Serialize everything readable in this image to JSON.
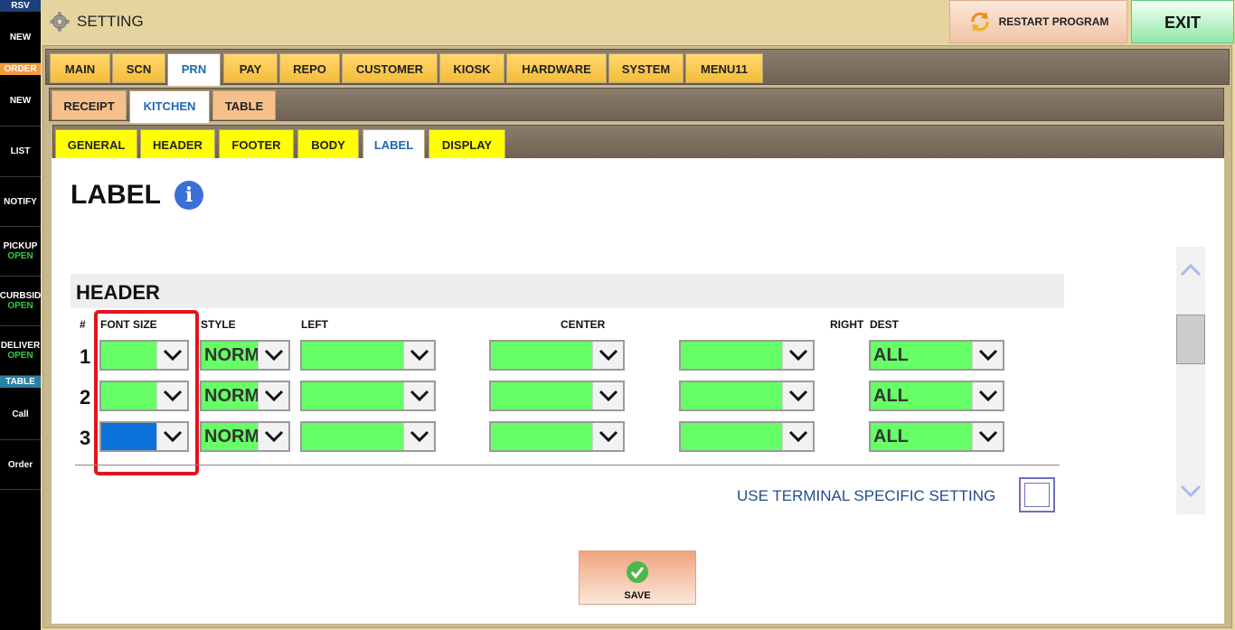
{
  "sidebar": {
    "badges": {
      "rsv": "RSV",
      "order": "ORDER",
      "table": "TABLE"
    },
    "items": [
      {
        "label": "NEW",
        "sub": ""
      },
      {
        "label": "NEW",
        "sub": ""
      },
      {
        "label": "LIST",
        "sub": ""
      },
      {
        "label": "NOTIFY",
        "sub": ""
      },
      {
        "label": "PICKUP",
        "sub": "OPEN"
      },
      {
        "label": "CURBSID",
        "sub": "OPEN"
      },
      {
        "label": "DELIVER",
        "sub": "OPEN"
      },
      {
        "label": "Call",
        "sub": ""
      },
      {
        "label": "Order",
        "sub": ""
      }
    ],
    "colors": {
      "badge_order": "#f39b3c",
      "badge_rsv": "#1f3f7a",
      "badge_table": "#2a7fa8",
      "open_text": "#2ecc40"
    }
  },
  "topbar": {
    "title": "SETTING",
    "restart_label": "RESTART PROGRAM",
    "exit_label": "EXIT",
    "icons": {
      "title": "gear-icon",
      "restart": "refresh-arrows-icon"
    }
  },
  "tabs_main": [
    "MAIN",
    "SCN",
    "PRN",
    "PAY",
    "REPO",
    "CUSTOMER",
    "KIOSK",
    "HARDWARE",
    "SYSTEM",
    "MENU11"
  ],
  "tabs_main_active": "PRN",
  "tabs_prn": [
    "RECEIPT",
    "KITCHEN",
    "TABLE"
  ],
  "tabs_prn_active": "KITCHEN",
  "tabs_kitchen": [
    "GENERAL",
    "HEADER",
    "FOOTER",
    "BODY",
    "LABEL",
    "DISPLAY"
  ],
  "tabs_kitchen_active": "LABEL",
  "page": {
    "title": "LABEL",
    "info_glyph": "i",
    "section_title": "HEADER",
    "columns": {
      "num": "#",
      "font_size": "FONT SIZE",
      "style": "STYLE",
      "left": "LEFT",
      "center": "CENTER",
      "right": "RIGHT",
      "dest": "DEST"
    },
    "rows": [
      {
        "num": "1",
        "font_size": "",
        "style": "NORMAL",
        "left": "",
        "center": "",
        "right": "",
        "dest": "ALL"
      },
      {
        "num": "2",
        "font_size": "",
        "style": "NORMAL",
        "left": "",
        "center": "",
        "right": "",
        "dest": "ALL"
      },
      {
        "num": "3",
        "font_size": "",
        "style": "NORMAL",
        "left": "",
        "center": "",
        "right": "",
        "dest": "ALL"
      }
    ],
    "terminal_specific_label": "USE TERMINAL SPECIFIC SETTING",
    "terminal_specific_checked": false,
    "save_label": "SAVE",
    "highlight_color": "#e0141e",
    "dropdown_color": "#66ff66",
    "selected_color": "#0a72d9"
  }
}
